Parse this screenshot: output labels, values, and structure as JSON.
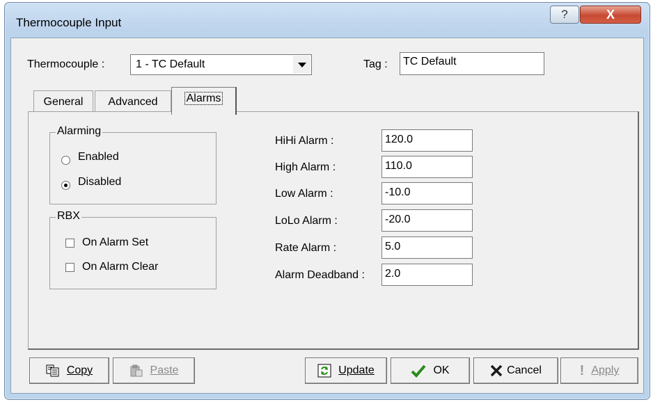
{
  "window": {
    "title": "Thermocouple Input",
    "help_glyph": "?",
    "close_glyph": "X"
  },
  "header": {
    "thermocouple_label": "Thermocouple :",
    "thermocouple_value": "1 - TC Default",
    "tag_label": "Tag :",
    "tag_value": "TC Default"
  },
  "tabs": [
    {
      "label": "General",
      "active": false
    },
    {
      "label": "Advanced",
      "active": false
    },
    {
      "label": "Alarms",
      "active": true
    }
  ],
  "alarming": {
    "title": "Alarming",
    "options": [
      {
        "label": "Enabled",
        "checked": false
      },
      {
        "label": "Disabled",
        "checked": true
      }
    ]
  },
  "rbx": {
    "title": "RBX",
    "options": [
      {
        "label": "On Alarm Set",
        "checked": false
      },
      {
        "label": "On Alarm Clear",
        "checked": false
      }
    ]
  },
  "alarms": [
    {
      "label": "HiHi Alarm :",
      "value": "120.0"
    },
    {
      "label": "High Alarm :",
      "value": "110.0"
    },
    {
      "label": "Low Alarm :",
      "value": "-10.0"
    },
    {
      "label": "LoLo Alarm :",
      "value": "-20.0"
    },
    {
      "label": "Rate Alarm :",
      "value": "5.0"
    },
    {
      "label": "Alarm Deadband :",
      "value": "2.0"
    }
  ],
  "buttons": {
    "copy": "Copy",
    "paste": "Paste",
    "update": "Update",
    "ok": "OK",
    "cancel": "Cancel",
    "apply": "Apply"
  },
  "icons": {
    "copy": "copy-icon",
    "paste": "paste-icon",
    "update": "update-icon",
    "ok": "checkmark-icon",
    "cancel": "x-icon",
    "apply": "exclamation-icon"
  },
  "colors": {
    "ok_green": "#2a8a1c",
    "cancel_dark": "#1a1a1a",
    "close_red": "#c74a33"
  }
}
